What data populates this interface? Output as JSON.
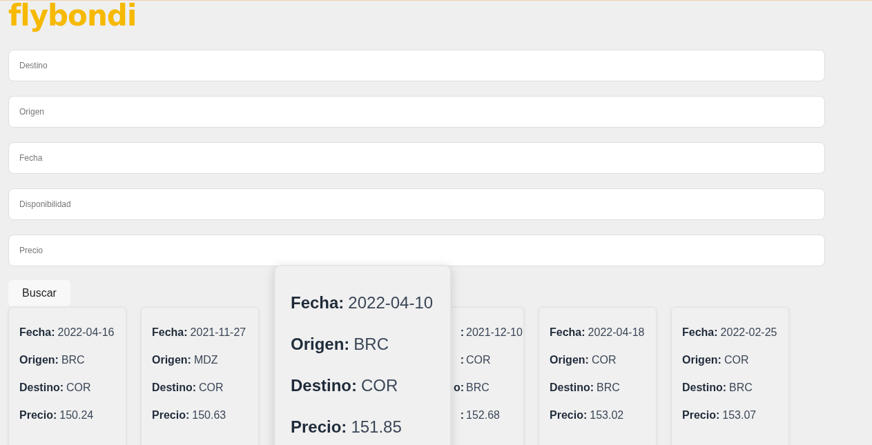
{
  "logo": {
    "text": "flybondi"
  },
  "fields": [
    {
      "placeholder": "Destino"
    },
    {
      "placeholder": "Origen"
    },
    {
      "placeholder": "Fecha"
    },
    {
      "placeholder": "Disponibilidad"
    },
    {
      "placeholder": "Precio"
    }
  ],
  "search_button": {
    "label": "Buscar"
  },
  "cards": [
    {
      "kind": "normal",
      "fields": [
        {
          "label": "Fecha:",
          "value": "2022-04-16"
        },
        {
          "label": "Origen:",
          "value": "BRC"
        },
        {
          "label": "Destino:",
          "value": "COR"
        },
        {
          "label": "Precio:",
          "value": "150.24"
        }
      ]
    },
    {
      "kind": "normal",
      "fields": [
        {
          "label": "Fecha:",
          "value": "2021-11-27"
        },
        {
          "label": "Origen:",
          "value": "MDZ"
        },
        {
          "label": "Destino:",
          "value": "COR"
        },
        {
          "label": "Precio:",
          "value": "150.63"
        }
      ]
    },
    {
      "kind": "enlarged",
      "fields": [
        {
          "label": "Fecha:",
          "value": "2022-04-10"
        },
        {
          "label": "Origen:",
          "value": "BRC"
        },
        {
          "label": "Destino:",
          "value": "COR"
        },
        {
          "label": "Precio:",
          "value": "151.85"
        }
      ]
    },
    {
      "kind": "partly_hidden",
      "fields": [
        {
          "label": ":",
          "value": "2021-12-10"
        },
        {
          "label": ":",
          "value": "COR"
        },
        {
          "label": "o:",
          "value": "BRC"
        },
        {
          "label": ":",
          "value": "152.68"
        }
      ]
    },
    {
      "kind": "normal",
      "fields": [
        {
          "label": "Fecha:",
          "value": "2022-04-18"
        },
        {
          "label": "Origen:",
          "value": "COR"
        },
        {
          "label": "Destino:",
          "value": "BRC"
        },
        {
          "label": "Precio:",
          "value": "153.02"
        }
      ]
    },
    {
      "kind": "normal",
      "fields": [
        {
          "label": "Fecha:",
          "value": "2022-02-25"
        },
        {
          "label": "Origen:",
          "value": "COR"
        },
        {
          "label": "Destino:",
          "value": "BRC"
        },
        {
          "label": "Precio:",
          "value": "153.07"
        }
      ]
    }
  ]
}
